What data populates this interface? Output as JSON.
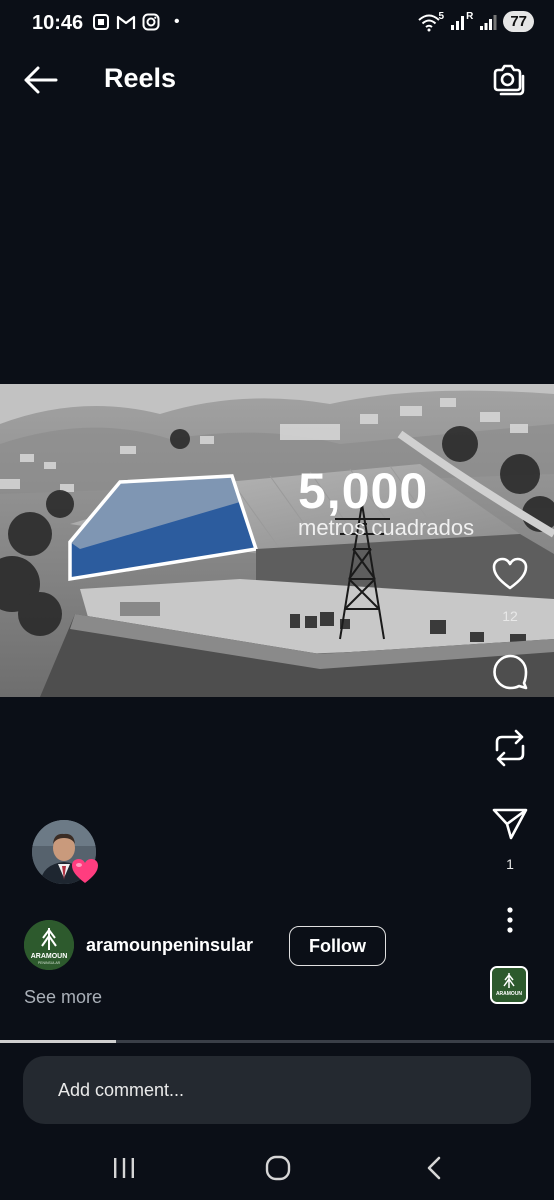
{
  "status_bar": {
    "time": "10:46",
    "dot": "•",
    "signal_label": "5",
    "roaming_label": "R",
    "battery": "77",
    "left_icons": [
      "screenshot-icon",
      "gmail-icon",
      "instagram-icon"
    ],
    "right_icons": [
      "wifi-icon",
      "signal-icon",
      "signal-icon-2",
      "battery-icon"
    ]
  },
  "header": {
    "title": "Reels",
    "back_icon": "arrow-left-icon",
    "camera_icon": "camera-icon"
  },
  "video": {
    "overlay_number": "5,000",
    "overlay_unit": "metros cuadrados"
  },
  "actions": {
    "like_count": "12",
    "share_count": "1",
    "icons": [
      "heart-icon",
      "comment-icon",
      "repost-icon",
      "send-icon",
      "more-icon"
    ]
  },
  "profile": {
    "username": "aramounpeninsular",
    "follow_label": "Follow",
    "see_more": "See more",
    "logo_text": "ARAMOUN",
    "logo_subtext": "PENINSULAR"
  },
  "progress": {
    "fraction": 0.21
  },
  "comment": {
    "placeholder": "Add comment..."
  },
  "nav": {
    "icons": [
      "recents-icon",
      "home-icon",
      "back-icon"
    ]
  },
  "colors": {
    "background": "#0b0f17",
    "warehouse_highlight": "#2c5c9e",
    "brand_green": "#2d5a2d",
    "heart_pink": "#ff3d7f"
  }
}
